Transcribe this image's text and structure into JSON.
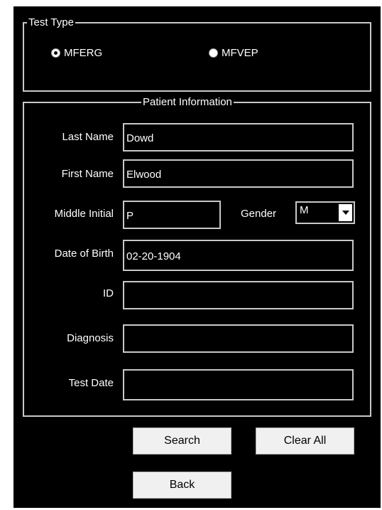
{
  "test_type": {
    "title": "Test Type",
    "options": [
      {
        "label": "MFERG",
        "checked": true
      },
      {
        "label": "MFVEP",
        "checked": false
      }
    ]
  },
  "patient": {
    "title": "Patient Information",
    "last_name": {
      "label": "Last Name",
      "value": "Dowd"
    },
    "first_name": {
      "label": "First Name",
      "value": "Elwood"
    },
    "middle_initial": {
      "label": "Middle Initial",
      "value": "P"
    },
    "gender": {
      "label": "Gender",
      "value": "M"
    },
    "dob": {
      "label": "Date of Birth",
      "value": "02-20-1904"
    },
    "id": {
      "label": "ID",
      "value": ""
    },
    "diagnosis": {
      "label": "Diagnosis",
      "value": ""
    },
    "test_date": {
      "label": "Test Date",
      "value": ""
    }
  },
  "buttons": {
    "search": "Search",
    "clear_all": "Clear All",
    "back": "Back"
  },
  "colors": {
    "background": "#000000",
    "border": "#c8c8c8",
    "button": "#f0f0f0"
  }
}
